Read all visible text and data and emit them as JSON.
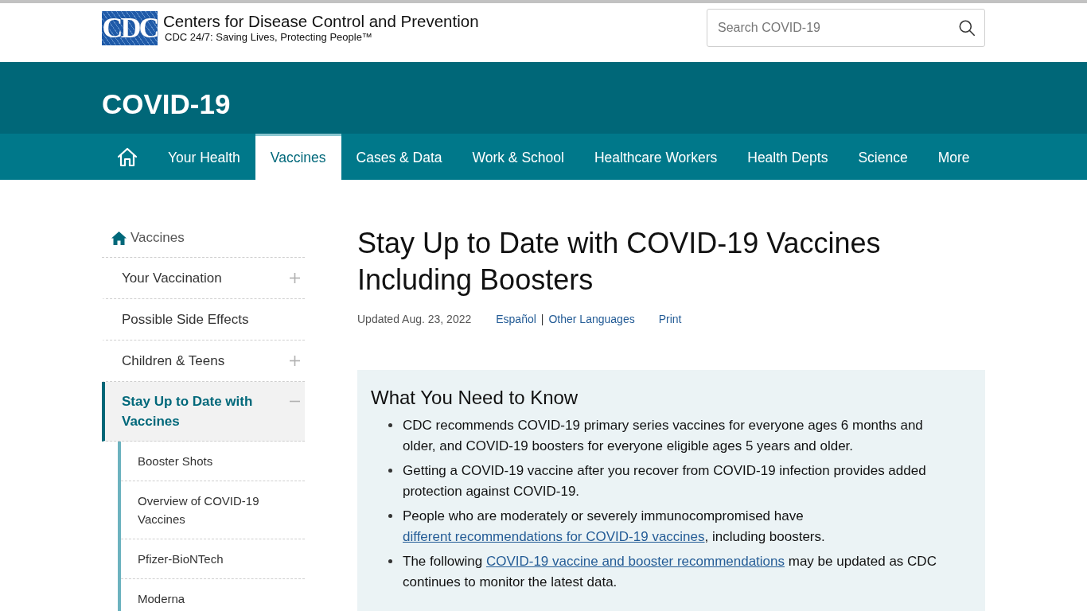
{
  "header": {
    "logo": {
      "mark": "CDC",
      "title": "Centers for Disease Control and Prevention",
      "tagline": "CDC 24/7: Saving Lives, Protecting People™"
    },
    "search": {
      "placeholder": "Search COVID-19"
    }
  },
  "banner": {
    "title": "COVID-19"
  },
  "nav": {
    "items": [
      {
        "label": "Your Health",
        "selected": false
      },
      {
        "label": "Vaccines",
        "selected": true
      },
      {
        "label": "Cases & Data",
        "selected": false
      },
      {
        "label": "Work & School",
        "selected": false
      },
      {
        "label": "Healthcare Workers",
        "selected": false
      },
      {
        "label": "Health Depts",
        "selected": false
      },
      {
        "label": "Science",
        "selected": false
      },
      {
        "label": "More",
        "selected": false
      }
    ]
  },
  "sidebar": {
    "home": {
      "label": "Vaccines"
    },
    "items": [
      {
        "label": "Your Vaccination",
        "kind": "expandable",
        "expanded": false,
        "selected": false
      },
      {
        "label": "Possible Side Effects",
        "kind": "link",
        "selected": false
      },
      {
        "label": "Children & Teens",
        "kind": "expandable",
        "expanded": false,
        "selected": false
      },
      {
        "label": "Stay Up to Date with Vaccines",
        "kind": "expandable",
        "expanded": true,
        "selected": true,
        "children": [
          {
            "label": "Booster Shots",
            "selected": false
          },
          {
            "label": "Overview of COVID-19 Vaccines",
            "selected": false
          },
          {
            "label": "Pfizer-BioNTech",
            "selected": false
          },
          {
            "label": "Moderna",
            "selected": false
          }
        ]
      }
    ]
  },
  "article": {
    "title": "Stay Up to Date with COVID-19 Vaccines Including Boosters",
    "updated": "Updated Aug. 23, 2022",
    "language_links": [
      "Español",
      "Other Languages"
    ],
    "separator": "|",
    "print": "Print",
    "callout": {
      "title": "What You Need to Know",
      "bullets": [
        {
          "parts": [
            {
              "kind": "text",
              "text": "CDC recommends COVID-19 primary series vaccines for everyone ages 6 months and older, and COVID-19 boosters for everyone eligible ages 5 years and older."
            }
          ]
        },
        {
          "parts": [
            {
              "kind": "text",
              "text": "Getting a COVID-19 vaccine after you recover from COVID-19 infection provides added protection against COVID-19."
            }
          ]
        },
        {
          "parts": [
            {
              "kind": "text",
              "text": "People who are moderately or severely immunocompromised have "
            },
            {
              "kind": "link",
              "text": "different recommendations for COVID-19 vaccines"
            },
            {
              "kind": "text",
              "text": ", including boosters."
            }
          ]
        },
        {
          "parts": [
            {
              "kind": "text",
              "text": "The following "
            },
            {
              "kind": "link",
              "text": "COVID-19 vaccine and booster recommendations"
            },
            {
              "kind": "text",
              "text": " may be updated as CDC continues to monitor the latest data."
            }
          ]
        }
      ]
    }
  }
}
